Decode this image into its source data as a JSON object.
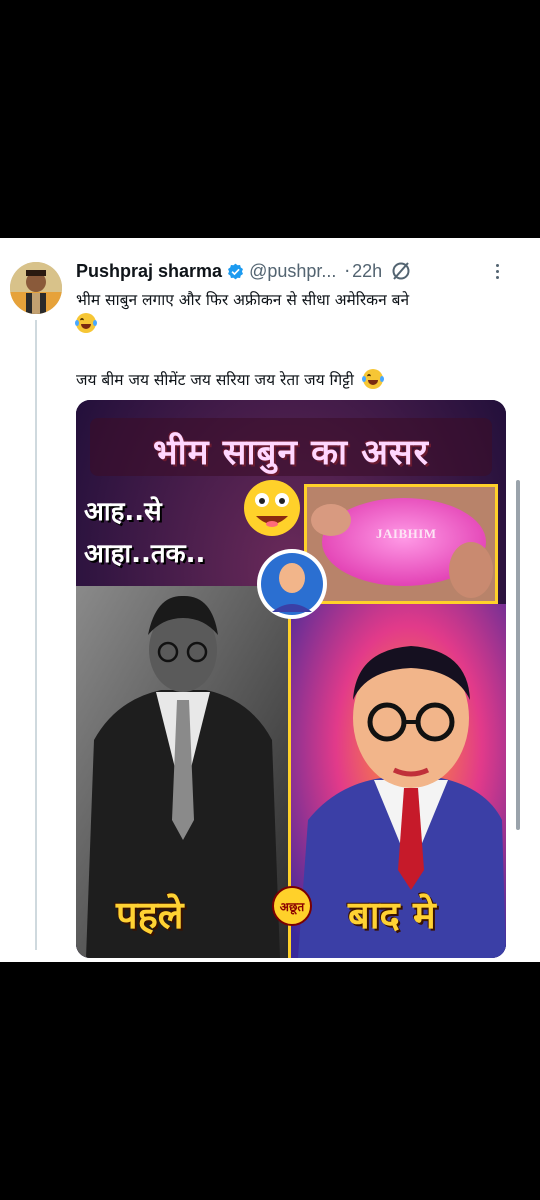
{
  "tweet": {
    "author_name": "Pushpraj sharma",
    "handle": "@pushpr...",
    "separator": "·",
    "time": "22h",
    "line1": "भीम साबुन लगाए और फिर अफ्रीकन से सीधा अमेरिकन बने",
    "line2": "जय बीम जय सीमेंट जय सरिया जय रेता जय गिट्टी",
    "verified_icon": "verified-badge-icon",
    "emoji": "face-with-tears-of-joy"
  },
  "media": {
    "headline": "भीम साबुन का असर",
    "caption_line1": "आह..से",
    "caption_line2": "आहा..तक..",
    "soap_text": "JAIBHIM",
    "label_before": "पहले",
    "label_after": "बाद मे",
    "badge_text": "अछूत"
  },
  "colors": {
    "accent_blue": "#1d9bf0",
    "label_yellow": "#ffd233",
    "headline_pink": "#ffd7ff"
  }
}
